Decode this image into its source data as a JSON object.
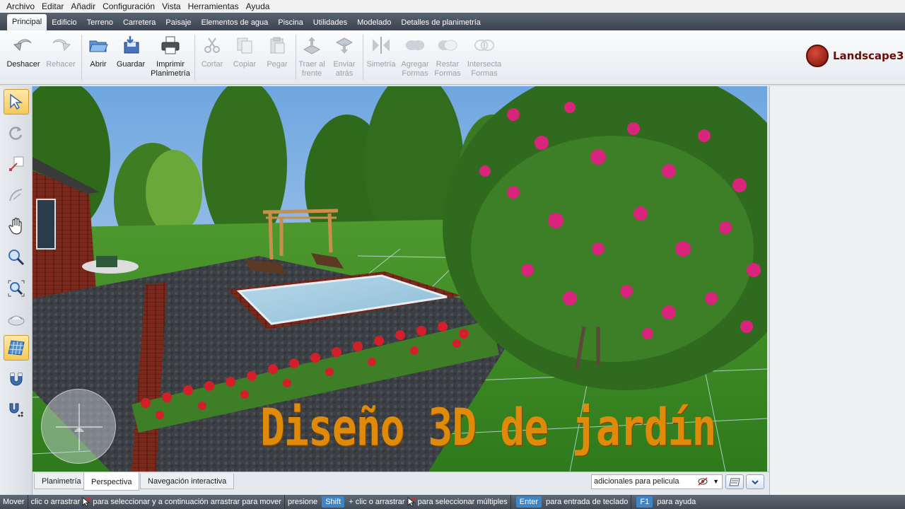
{
  "menu": [
    "Archivo",
    "Editar",
    "Añadir",
    "Configuración",
    "Vista",
    "Herramientas",
    "Ayuda"
  ],
  "tabs": [
    "Principal",
    "Edificio",
    "Terreno",
    "Carretera",
    "Paisaje",
    "Elementos de agua",
    "Piscina",
    "Utilidades",
    "Modelado",
    "Detalles de planimetría"
  ],
  "active_tab": "Principal",
  "ribbon": {
    "undo": "Deshacer",
    "redo": "Rehacer",
    "open": "Abrir",
    "save": "Guardar",
    "print": "Imprimir Planimetría",
    "cut": "Cortar",
    "copy": "Copiar",
    "paste": "Pegar",
    "bring_front": "Traer al frente",
    "send_back": "Enviar atrás",
    "symmetry": "Simetría",
    "add_shapes": "Agregar Formas",
    "subtract_shapes": "Restar Formas",
    "intersect_shapes": "Intersecta Formas"
  },
  "logo": "Landscape3",
  "overlay_title": "Diseño 3D de jardín",
  "view_tabs": [
    "Planimetría",
    "Perspectiva",
    "Navegación interactiva"
  ],
  "active_view": "Perspectiva",
  "view_select": "adicionales para pelicula",
  "status": {
    "mode": "Mover",
    "seg1": "clic o arrastrar",
    "seg2": "para seleccionar y a continuación arrastrar para mover",
    "seg3": "presione",
    "key_shift": "Shift",
    "plus": "+",
    "seg4": "clic o arrastrar",
    "seg5": "para seleccionar múltiples",
    "key_enter": "Enter",
    "seg6": "para entrada de teclado",
    "key_f1": "F1",
    "seg7": "para ayuda"
  },
  "colors": {
    "accent": "#3f86c8",
    "title_overlay": "#e08a0a",
    "selected_tool": "#f6c95a"
  }
}
